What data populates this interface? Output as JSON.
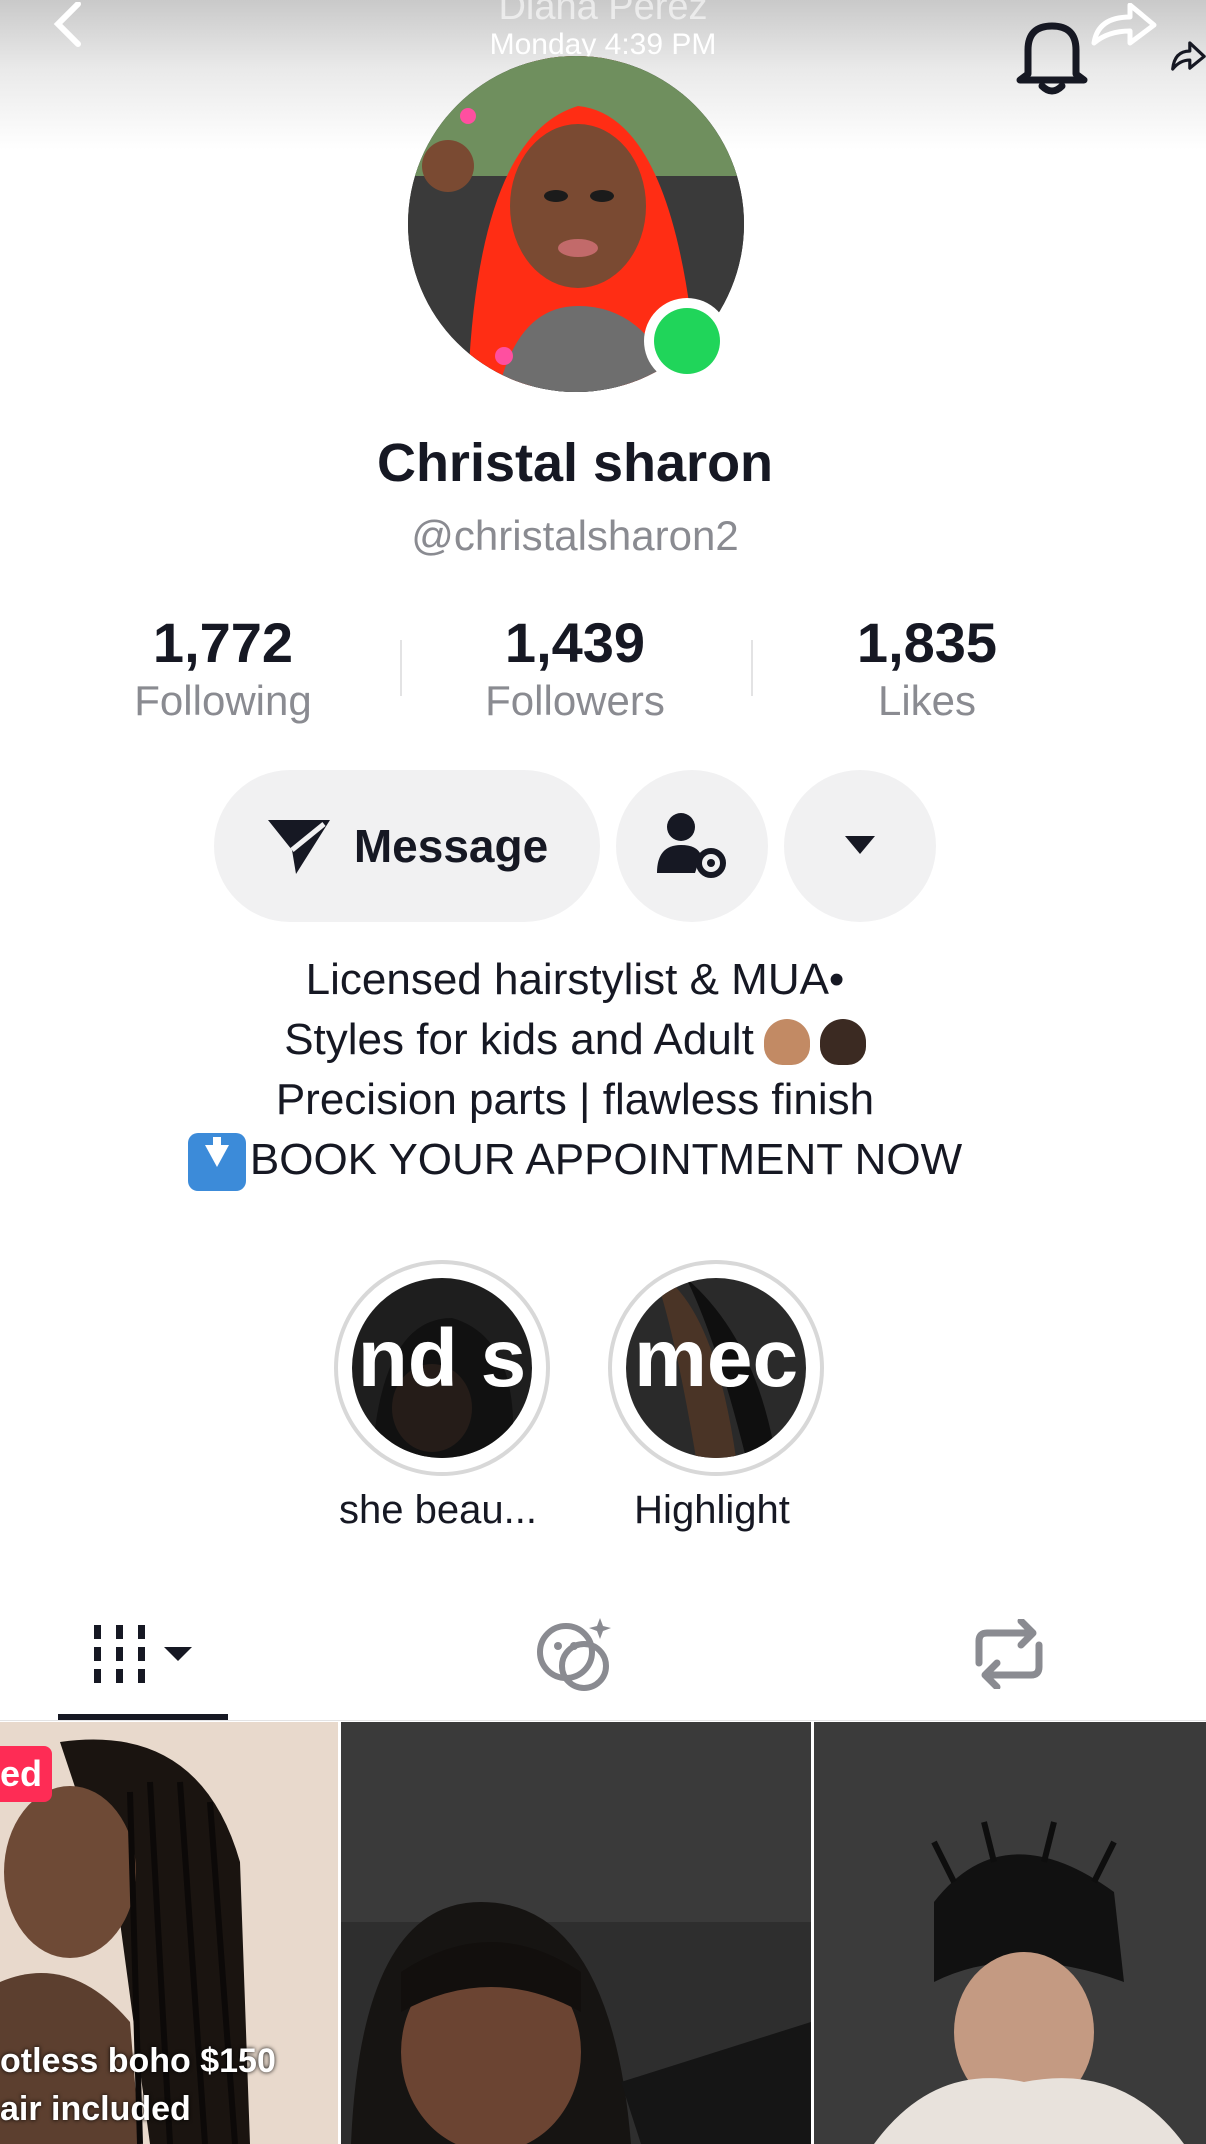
{
  "header": {
    "title": "Diana Perez",
    "subtitle": "Monday 4:39 PM",
    "back_icon": "chevron-left-icon",
    "bell_icon": "bell-icon",
    "share_icon": "share-arrow-icon"
  },
  "profile": {
    "name": "Christal sharon",
    "handle": "@christalsharon2",
    "online_color": "#20d55a"
  },
  "stats": [
    {
      "value": "1,772",
      "label": "Following"
    },
    {
      "value": "1,439",
      "label": "Followers"
    },
    {
      "value": "1,835",
      "label": "Likes"
    }
  ],
  "actions": {
    "message_label": "Message",
    "add_friend_icon": "person-gear-icon",
    "more_icon": "caret-down-icon"
  },
  "bio": {
    "line1": "Licensed hairstylist & MUA•",
    "line2": "Styles for kids and Adult",
    "line3": "Precision parts | flawless finish",
    "line4": "BOOK YOUR APPOINTMENT NOW"
  },
  "highlights": [
    {
      "label": "she beau...",
      "overlay": "nd s"
    },
    {
      "label": "Highlight",
      "overlay": "mec"
    }
  ],
  "tabs": [
    "videos-grid-icon",
    "reposts-face-icon",
    "repost-arrows-icon"
  ],
  "grid": [
    {
      "badge": "ed",
      "caption_line1": "otless boho $150",
      "caption_line2": "air included"
    },
    {},
    {}
  ],
  "colors": {
    "accent_red": "#fe2c55",
    "text": "#161823",
    "muted": "#8a8b91"
  }
}
